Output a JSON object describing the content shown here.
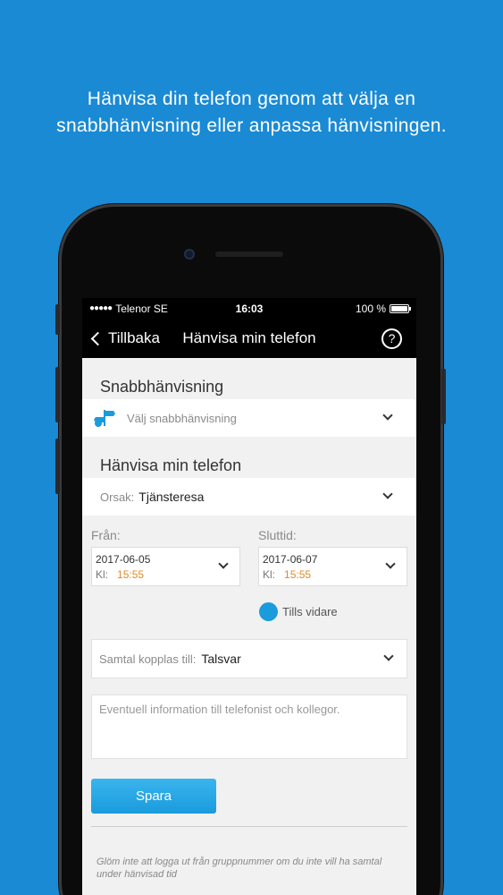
{
  "headline": {
    "line1": "Hänvisa din telefon genom att välja en",
    "line2": "snabbhänvisning eller anpassa hänvisningen."
  },
  "statusbar": {
    "carrier": "Telenor SE",
    "time": "16:03",
    "battery": "100 %"
  },
  "navbar": {
    "back_label": "Tillbaka",
    "title": "Hänvisa min telefon",
    "help": "?"
  },
  "quick": {
    "section_title": "Snabbhänvisning",
    "placeholder": "Välj snabbhänvisning"
  },
  "redirect": {
    "section_title": "Hänvisa min telefon",
    "reason_label": "Orsak:",
    "reason_value": "Tjänsteresa"
  },
  "from": {
    "label": "Från:",
    "date": "2017-06-05",
    "time_label": "Kl:",
    "time": "15:55"
  },
  "to": {
    "label": "Sluttid:",
    "date": "2017-06-07",
    "time_label": "Kl:",
    "time": "15:55"
  },
  "until_further": "Tills vidare",
  "call_routing": {
    "label": "Samtal kopplas till:",
    "value": "Talsvar"
  },
  "info_placeholder": "Eventuell information till telefonist och kollegor.",
  "save_label": "Spara",
  "footnote": "Glöm inte att logga ut från gruppnummer om du inte vill ha samtal under hänvisad tid",
  "colors": {
    "background": "#1a8ad4",
    "accent": "#1a9bdc",
    "time_orange": "#e08a2a"
  }
}
